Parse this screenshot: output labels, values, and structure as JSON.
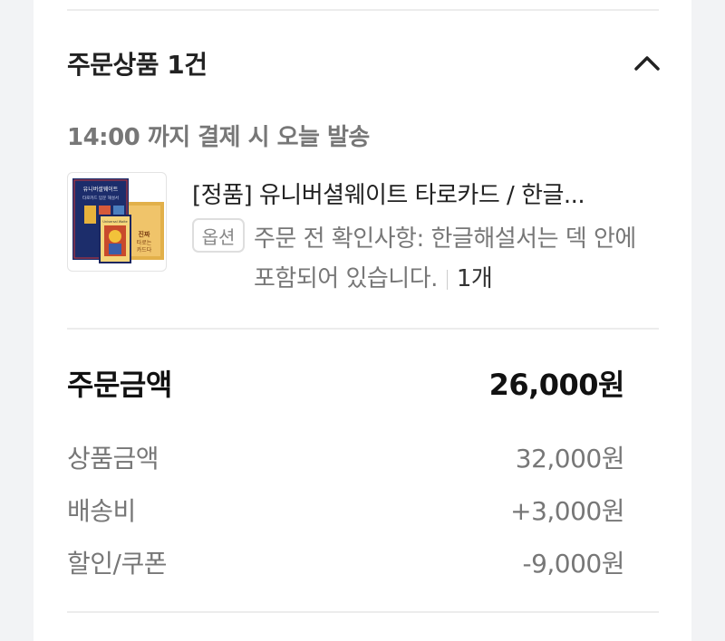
{
  "order_items": {
    "title": "주문상품 1건",
    "shipping_notice": "14:00 까지 결제 시 오늘 발송",
    "collapse_icon": "chevron-up-icon",
    "product": {
      "name": "[정품] 유니버셜웨이트 타로카드 / 한글...",
      "option_badge": "옵션",
      "option_text": "주문 전 확인사항: 한글해설서는 덱 안에 포함되어 있습니다.",
      "quantity": "1개",
      "thumbnail_text_1": "유니버셜웨이트",
      "thumbnail_text_2": "타로카드 입문 해설서",
      "thumbnail_text_3": "Universal Waite",
      "thumbnail_text_4": "진짜",
      "thumbnail_text_5": "타로는",
      "thumbnail_text_6": "카드다"
    }
  },
  "summary": {
    "total_label": "주문금액",
    "total_value": "26,000원",
    "rows": [
      {
        "label": "상품금액",
        "value": "32,000원"
      },
      {
        "label": "배송비",
        "value": "+3,000원"
      },
      {
        "label": "할인/쿠폰",
        "value": "-9,000원"
      }
    ]
  },
  "colors": {
    "background": "#f2f3f5",
    "card": "#ffffff",
    "divider": "#ececec",
    "muted_text": "#777777",
    "book_blue": "#1c2d6b",
    "book_gold": "#e2b04a"
  }
}
